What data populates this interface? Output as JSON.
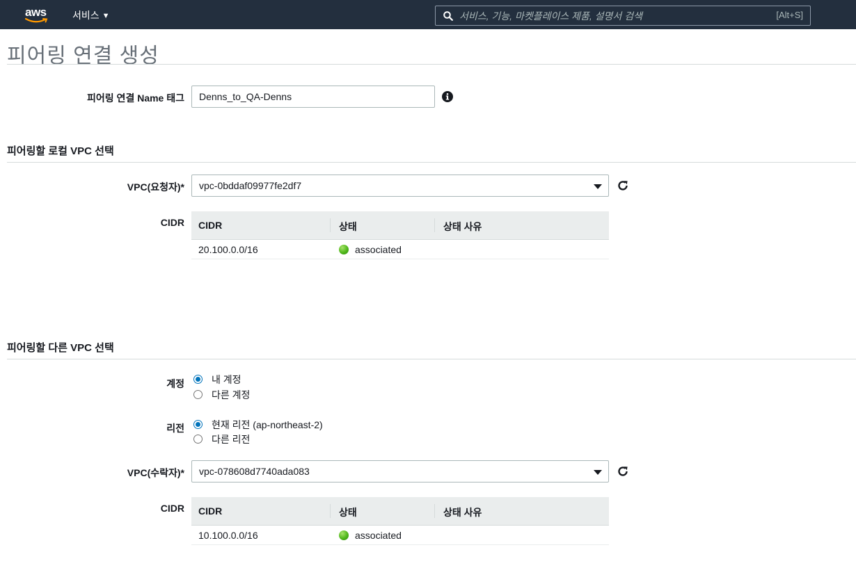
{
  "nav": {
    "logo_text": "aws",
    "services_label": "서비스",
    "search_placeholder": "서비스, 기능, 마켓플레이스 제품, 설명서 검색",
    "search_shortcut": "[Alt+S]"
  },
  "page": {
    "title": "피어링 연결 생성"
  },
  "name_tag": {
    "label": "피어링 연결 Name 태그",
    "value": "Denns_to_QA-Denns"
  },
  "local_section": {
    "heading": "피어링할 로컬 VPC 선택",
    "vpc_label": "VPC(요청자)*",
    "vpc_value": "vpc-0bddaf09977fe2df7",
    "cidr_label": "CIDR",
    "table": {
      "headers": [
        "CIDR",
        "상태",
        "상태 사유"
      ],
      "rows": [
        {
          "cidr": "20.100.0.0/16",
          "status": "associated",
          "reason": ""
        }
      ]
    }
  },
  "peer_section": {
    "heading": "피어링할 다른 VPC 선택",
    "account_label": "계정",
    "account_options": [
      "내 계정",
      "다른 계정"
    ],
    "account_selected": "내 계정",
    "region_label": "리전",
    "region_options": [
      "현재 리전 (ap-northeast-2)",
      "다른 리전"
    ],
    "region_selected": "현재 리전 (ap-northeast-2)",
    "vpc_label": "VPC(수락자)*",
    "vpc_value": "vpc-078608d7740ada083",
    "cidr_label": "CIDR",
    "table": {
      "headers": [
        "CIDR",
        "상태",
        "상태 사유"
      ],
      "rows": [
        {
          "cidr": "10.100.0.0/16",
          "status": "associated",
          "reason": ""
        }
      ]
    }
  },
  "colors": {
    "nav_bg": "#232f3e",
    "status_green": "#4fb71a",
    "radio_selected": "#0073bb"
  }
}
